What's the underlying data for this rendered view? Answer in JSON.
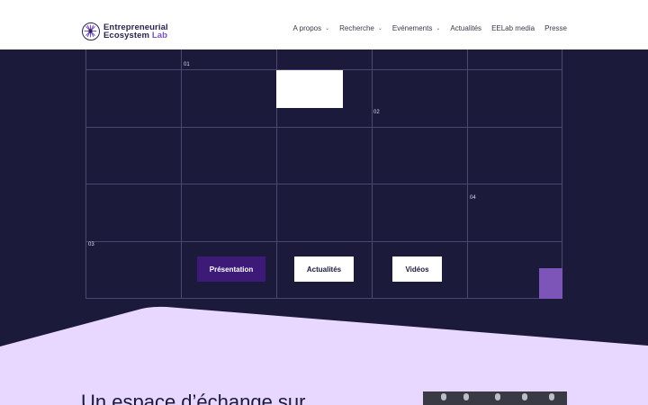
{
  "header": {
    "logo_line1": "Entrepreneurial",
    "logo_line2_a": "Ecosystem",
    "logo_line2_b": "Lab",
    "nav": [
      {
        "label": "A propos",
        "dropdown": true
      },
      {
        "label": "Recherche",
        "dropdown": true
      },
      {
        "label": "Evénements",
        "dropdown": true
      },
      {
        "label": "Actualités",
        "dropdown": false
      },
      {
        "label": "EELab media",
        "dropdown": false
      },
      {
        "label": "Presse",
        "dropdown": false
      }
    ]
  },
  "grid": {
    "numbers": [
      "01",
      "02",
      "03",
      "04"
    ]
  },
  "buttons": {
    "presentation": "Présentation",
    "actualites": "Actualités",
    "videos": "Vidéos"
  },
  "section": {
    "headline": "Un espace d’échange sur"
  },
  "colors": {
    "dark_bg": "#1c1a3a",
    "lavender": "#e8d7ff",
    "accent_purple": "#3d1a78",
    "block_purple": "#7d55b8"
  }
}
